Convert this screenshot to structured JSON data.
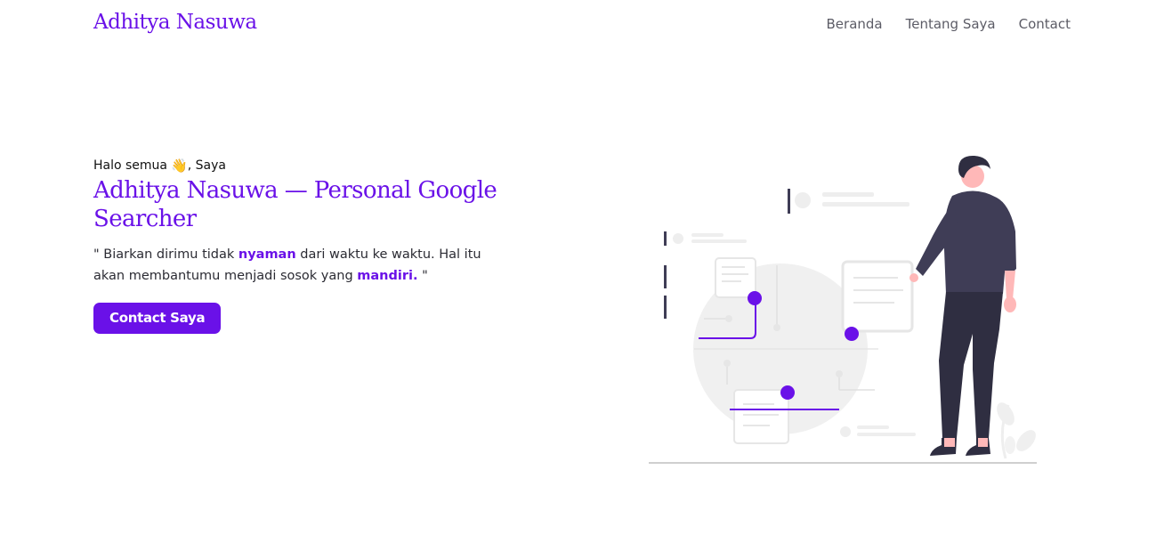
{
  "nav": {
    "brand": "Adhitya Nasuwa",
    "links": [
      "Beranda",
      "Tentang Saya",
      "Contact"
    ]
  },
  "hero": {
    "greeting_prefix": "Halo semua",
    "greeting_suffix": ", Saya",
    "wave_icon": "👋",
    "title": "Adhitya Nasuwa — Personal Google Searcher",
    "quote_part1": "\" Biarkan dirimu tidak ",
    "quote_highlight1": "nyaman",
    "quote_part2": " dari waktu ke waktu. Hal itu akan membantumu menjadi sosok yang ",
    "quote_highlight2": "mandiri.",
    "quote_part3": " \"",
    "cta_label": "Contact Saya"
  },
  "colors": {
    "accent": "#6a11e8",
    "nav_text": "#5c5c66",
    "illustration_gray": "#f0f0f0",
    "person_dark": "#2f2e41"
  },
  "icons": {
    "wave": "waving-hand-icon",
    "illustration": "person-with-search-diagram-illustration"
  }
}
